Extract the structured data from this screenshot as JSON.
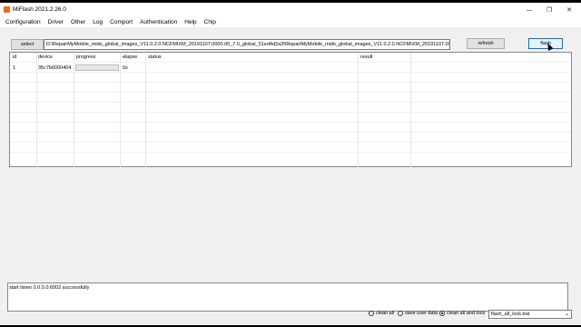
{
  "window": {
    "title": "MiFlash 2021.2.26.0"
  },
  "menu": [
    "Configuration",
    "Driver",
    "Other",
    "Log",
    "Comport",
    "Authentication",
    "Help",
    "Chip"
  ],
  "toolbar": {
    "select_label": "select",
    "path_value": "D:\\RepairMyMobile_mido_global_images_V11.0.2.0.NCFMIXM_20191107.0000.00_7.0_global_51ed4d2a3f\\RepairMyMobile_mido_global_images_V11.0.2.0.NCFMIXM_20191107.0000.00_7.0_global",
    "refresh_label": "refresh",
    "flash_label": "flash"
  },
  "table": {
    "headers": [
      "id",
      "device",
      "progress",
      "elapse",
      "status",
      "result"
    ],
    "rows": [
      {
        "id": "1",
        "device": "35c7b6000404",
        "progress": 0,
        "elapse": "0s",
        "status": "",
        "result": ""
      }
    ]
  },
  "log": {
    "text": "start listen 0.0.0.0:6002 successfully"
  },
  "options": {
    "clean_all": "clean all",
    "save_user_data": "save user data",
    "clean_all_lock": "clean all and lock",
    "selected": "clean_all_lock",
    "script_value": "flash_all_lock.bat"
  }
}
